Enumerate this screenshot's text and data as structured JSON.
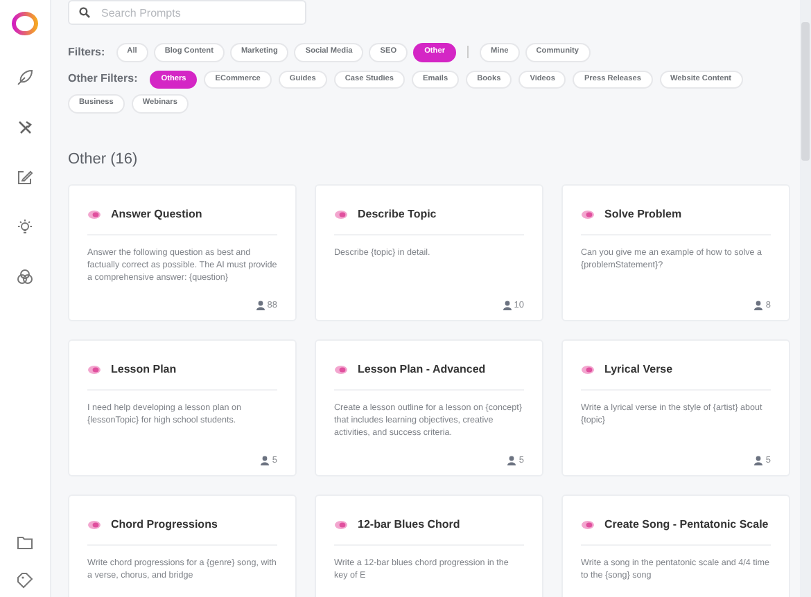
{
  "search": {
    "placeholder": "Search Prompts"
  },
  "filters": {
    "label": "Filters:",
    "items": [
      {
        "label": "All",
        "selected": false
      },
      {
        "label": "Blog Content",
        "selected": false
      },
      {
        "label": "Marketing",
        "selected": false
      },
      {
        "label": "Social Media",
        "selected": false
      },
      {
        "label": "SEO",
        "selected": false
      },
      {
        "label": "Other",
        "selected": true
      }
    ],
    "owner_items": [
      {
        "label": "Mine",
        "selected": false
      },
      {
        "label": "Community",
        "selected": false
      }
    ]
  },
  "other_filters": {
    "label": "Other Filters:",
    "items": [
      {
        "label": "Others",
        "selected": true
      },
      {
        "label": "ECommerce",
        "selected": false
      },
      {
        "label": "Guides",
        "selected": false
      },
      {
        "label": "Case Studies",
        "selected": false
      },
      {
        "label": "Emails",
        "selected": false
      },
      {
        "label": "Books",
        "selected": false
      },
      {
        "label": "Videos",
        "selected": false
      },
      {
        "label": "Press Releases",
        "selected": false
      },
      {
        "label": "Website Content",
        "selected": false
      },
      {
        "label": "Business",
        "selected": false
      },
      {
        "label": "Webinars",
        "selected": false
      }
    ]
  },
  "section_title": "Other (16)",
  "cards": [
    {
      "title": "Answer Question",
      "description": "Answer the following question as best and factually correct as possible. The AI must provide a comprehensive answer: {question}",
      "users": "88"
    },
    {
      "title": "Describe Topic",
      "description": "Describe {topic} in detail.",
      "users": "10"
    },
    {
      "title": "Solve Problem",
      "description": "Can you give me an example of how to solve a {problemStatement}?",
      "users": "8"
    },
    {
      "title": "Lesson Plan",
      "description": "I need help developing a lesson plan on {lessonTopic} for high school students.",
      "users": "5"
    },
    {
      "title": "Lesson Plan - Advanced",
      "description": "Create a lesson outline for a lesson on {concept} that includes learning objectives, creative activities, and success criteria.",
      "users": "5"
    },
    {
      "title": "Lyrical Verse",
      "description": "Write a lyrical verse in the style of {artist} about {topic}",
      "users": "5"
    },
    {
      "title": "Chord Progressions",
      "description": "Write chord progressions for a {genre} song, with a verse, chorus, and bridge"
    },
    {
      "title": "12-bar Blues Chord",
      "description": "Write a 12-bar blues chord progression in the key of E"
    },
    {
      "title": "Create Song - Pentatonic Scale",
      "description": "Write a song in the pentatonic scale and 4/4 time to the {song} song"
    }
  ]
}
